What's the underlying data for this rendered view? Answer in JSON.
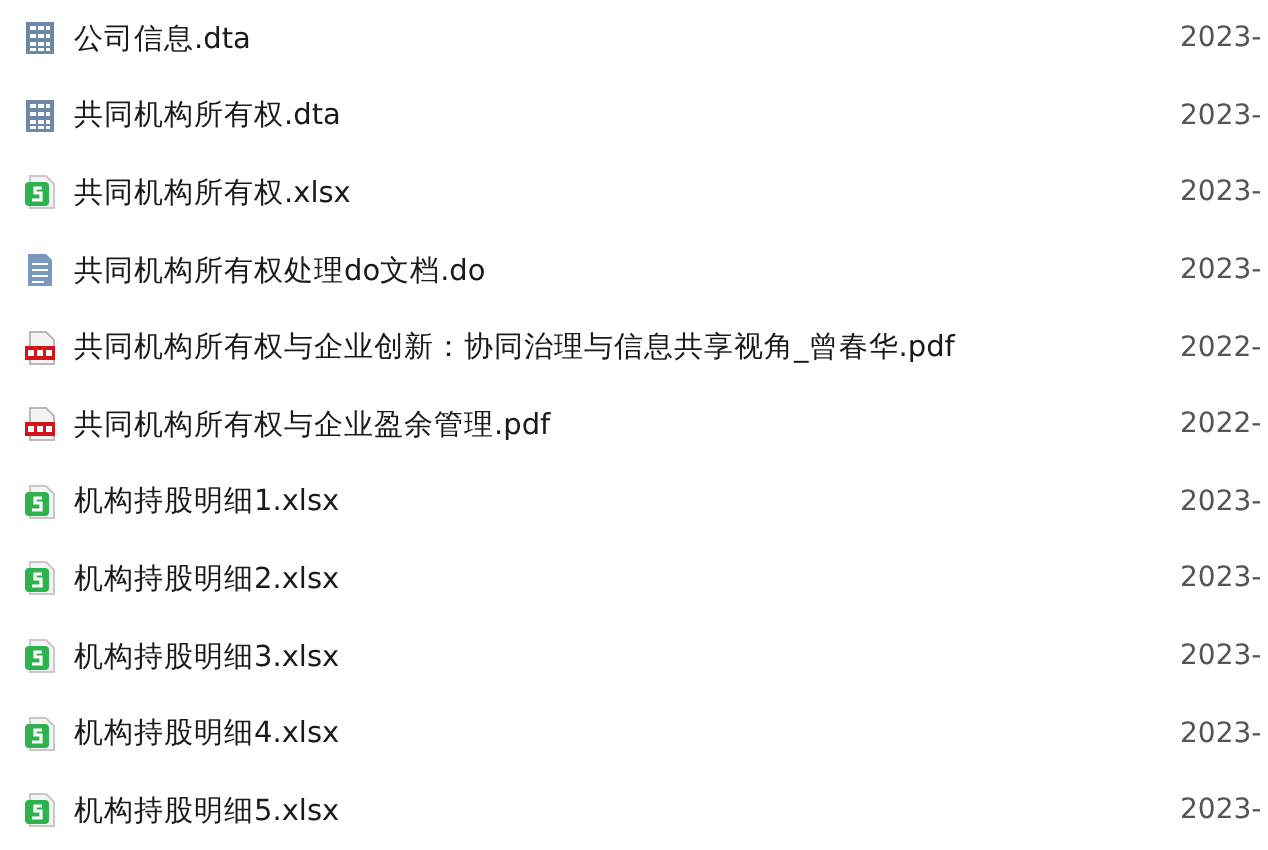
{
  "files": [
    {
      "kind": "dta",
      "name": "公司信息.dta",
      "date": "2023-"
    },
    {
      "kind": "dta",
      "name": "共同机构所有权.dta",
      "date": "2023-"
    },
    {
      "kind": "xlsx",
      "name": "共同机构所有权.xlsx",
      "date": "2023-"
    },
    {
      "kind": "doc",
      "name": "共同机构所有权处理do文档.do",
      "date": "2023-"
    },
    {
      "kind": "pdf",
      "name": "共同机构所有权与企业创新：协同治理与信息共享视角_曾春华.pdf",
      "date": "2022-"
    },
    {
      "kind": "pdf",
      "name": "共同机构所有权与企业盈余管理.pdf",
      "date": "2022-"
    },
    {
      "kind": "xlsx",
      "name": "机构持股明细1.xlsx",
      "date": "2023-"
    },
    {
      "kind": "xlsx",
      "name": "机构持股明细2.xlsx",
      "date": "2023-"
    },
    {
      "kind": "xlsx",
      "name": "机构持股明细3.xlsx",
      "date": "2023-"
    },
    {
      "kind": "xlsx",
      "name": "机构持股明细4.xlsx",
      "date": "2023-"
    },
    {
      "kind": "xlsx",
      "name": "机构持股明细5.xlsx",
      "date": "2023-"
    }
  ]
}
